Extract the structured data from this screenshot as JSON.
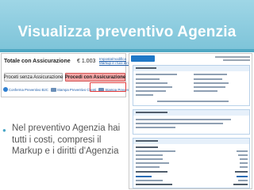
{
  "slide": {
    "title": "Visualizza preventivo Agenzia"
  },
  "quote": {
    "total_label": "Totale con Assicurazione",
    "total_value": "€ 1.003",
    "edit_link_lines": [
      "Imposta/modifica",
      "Markup e i tuoi diritti d'agenzia"
    ],
    "btn_without": "Proceti senza Assicurazione",
    "btn_with": "Procedi con Assicurazione",
    "actions": [
      "Conferma Preventivo B2C",
      "Stampa Preventivo Clienti",
      "Stampa Preventivo Agenzia"
    ]
  },
  "bullet": {
    "text": "Nel preventivo Agenzia hai tutti i costi, compresi il Markup e i diritti d'Agenzia"
  },
  "colors": {
    "header": "#7cc3d8",
    "title": "#ffffff",
    "bullet": "#49a6c6",
    "highlight": "#e53b3b"
  }
}
